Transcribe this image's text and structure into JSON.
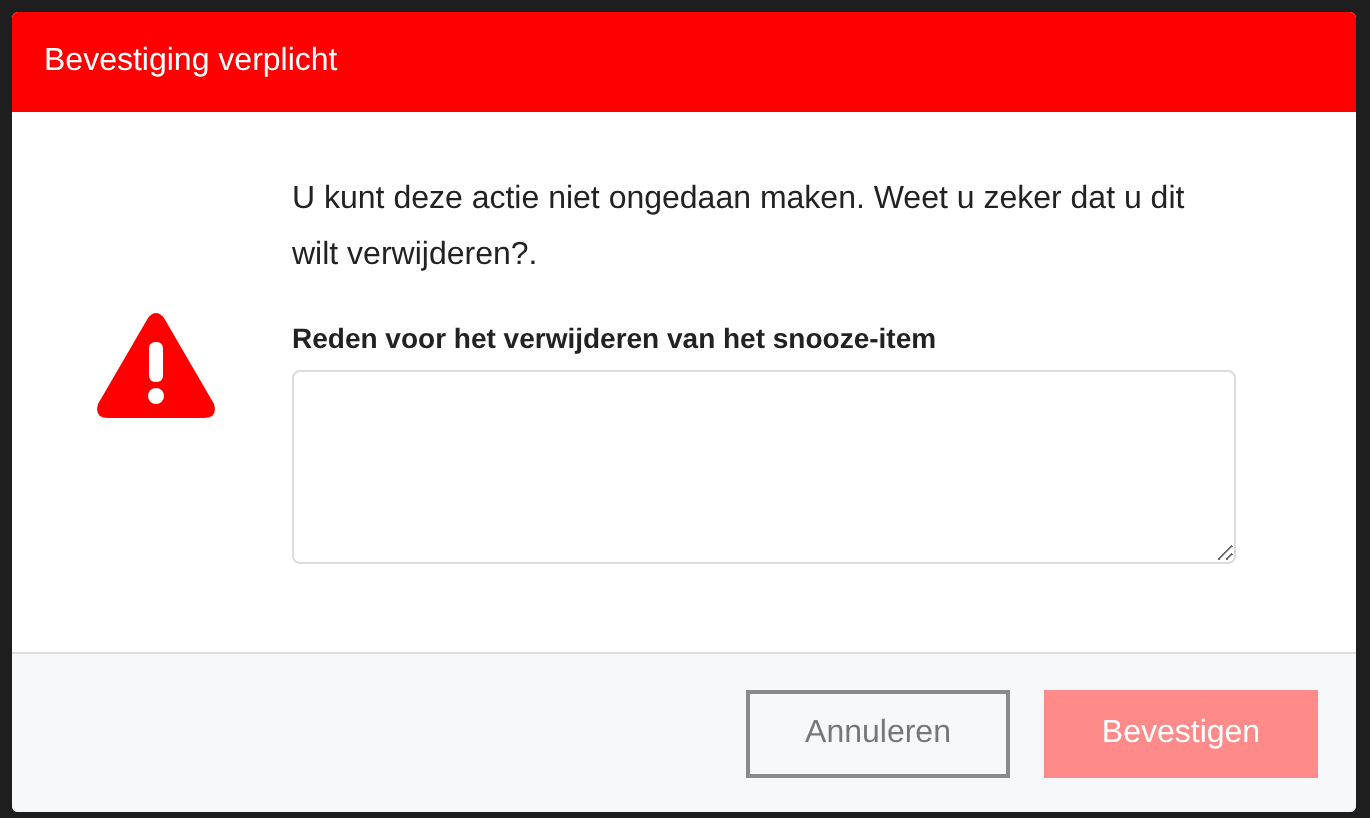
{
  "dialog": {
    "title": "Bevestiging verplicht",
    "message": "U kunt deze actie niet ongedaan maken. Weet u zeker dat u dit wilt verwijderen?.",
    "reason_field": {
      "label": "Reden voor het verwijderen van het snooze-item"
    },
    "buttons": [
      {
        "kind": "secondary",
        "label": "Annuleren",
        "disabled": false
      },
      {
        "kind": "primary",
        "label": "Bevestigen",
        "disabled": true
      }
    ]
  }
}
